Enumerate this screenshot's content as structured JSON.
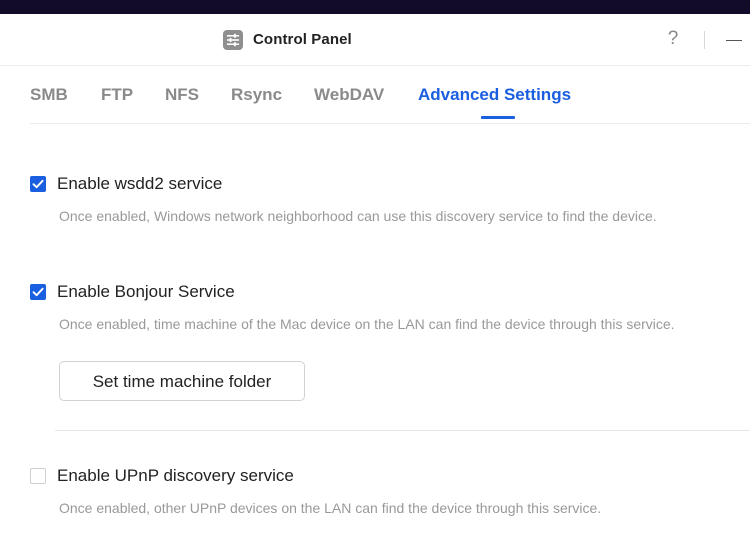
{
  "window": {
    "title": "Control Panel",
    "app_icon": "control-panel-icon",
    "help_label": "?",
    "minimize_icon": "minimize-icon"
  },
  "tabs": [
    {
      "label": "SMB",
      "active": false
    },
    {
      "label": "FTP",
      "active": false
    },
    {
      "label": "NFS",
      "active": false
    },
    {
      "label": "Rsync",
      "active": false
    },
    {
      "label": "WebDAV",
      "active": false
    },
    {
      "label": "Advanced Settings",
      "active": true
    }
  ],
  "settings": {
    "wsdd2": {
      "label": "Enable wsdd2 service",
      "checked": true,
      "description": "Once enabled, Windows network neighborhood can use this discovery service to find the device."
    },
    "bonjour": {
      "label": "Enable Bonjour Service",
      "checked": true,
      "description": "Once enabled, time machine of the Mac device on the LAN can find the device through this service.",
      "button_label": "Set time machine folder"
    },
    "upnp": {
      "label": "Enable UPnP discovery service",
      "checked": false,
      "description": "Once enabled, other UPnP devices on the LAN can find the device through this service."
    }
  },
  "colors": {
    "accent": "#1a5fe0",
    "text": "#222222",
    "muted": "#999999",
    "tab_inactive": "#8a8a8a",
    "top_strip": "#120c2a"
  }
}
